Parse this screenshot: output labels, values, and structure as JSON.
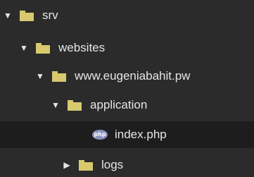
{
  "tree": {
    "items": [
      {
        "label": "srv",
        "expanded": true,
        "type": "folder",
        "icon": "folder-icon",
        "arrow": "▼"
      },
      {
        "label": "websites",
        "expanded": true,
        "type": "folder",
        "icon": "folder-icon",
        "arrow": "▼"
      },
      {
        "label": "www.eugeniabahit.pw",
        "expanded": true,
        "type": "folder",
        "icon": "folder-icon",
        "arrow": "▼"
      },
      {
        "label": "application",
        "expanded": true,
        "type": "folder",
        "icon": "folder-icon",
        "arrow": "▼"
      },
      {
        "label": "index.php",
        "type": "file",
        "icon": "php-file-icon",
        "icon_text": "php",
        "selected": true
      },
      {
        "label": "logs",
        "expanded": false,
        "type": "folder",
        "icon": "folder-icon",
        "arrow": "▶"
      }
    ]
  },
  "colors": {
    "background": "#2b2b2b",
    "selected_row": "#1d1d1d",
    "folder": "#d8c96e",
    "php_badge": "#8892bf",
    "text": "#e6e6e6"
  }
}
